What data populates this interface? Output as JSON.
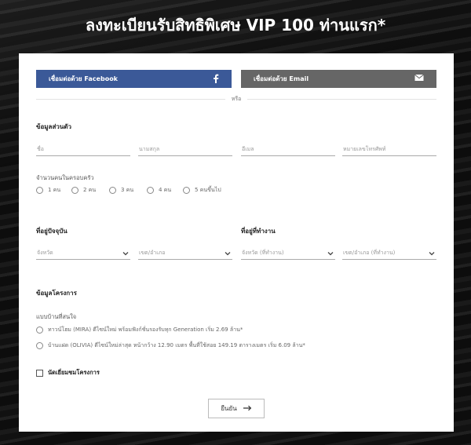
{
  "page": {
    "title": "ลงทะเบียนรับสิทธิพิเศษ VIP 100 ท่านแรก*"
  },
  "social": {
    "facebook_label": "เชื่อมต่อด้วย Facebook",
    "email_label": "เชื่อมต่อด้วย Email",
    "or_text": "หรือ"
  },
  "personal": {
    "title": "ข้อมูลส่วนตัว",
    "first_name_placeholder": "ชื่อ",
    "last_name_placeholder": "นามสกุล",
    "email_placeholder": "อีเมล",
    "phone_placeholder": "หมายเลขโทรศัพท์"
  },
  "family": {
    "label": "จำนวนคนในครอบครัว",
    "options": [
      "1 คน",
      "2 คน",
      "3 คน",
      "4 คน",
      "5 คนขึ้นไป"
    ]
  },
  "current_address": {
    "title": "ที่อยู่ปัจจุบัน",
    "province": "จังหวัด",
    "district": "เขต/อำเภอ"
  },
  "work_address": {
    "title": "ที่อยู่ที่ทำงาน",
    "province": "จังหวัด (ที่ทำงาน)",
    "district": "เขต/อำเภอ (ที่ทำงาน)"
  },
  "project": {
    "title": "ข้อมูลโครงการ",
    "interest_label": "แบบบ้านที่สนใจ",
    "options": [
      "ทาวน์โฮม (MIRA) ดีไซน์ใหม่ พร้อมฟังก์ชั่นรองรับทุก Generation เริ่ม 2.69 ล้าน*",
      "บ้านแฝด (OLIVIA) ดีไซน์ใหม่ล่าสุด หน้ากว้าง 12.90 เมตร พื้นที่ใช้สอย 149.19 ตารางเมตร เริ่ม 6.09 ล้าน*"
    ],
    "appointment_label": "นัดเยี่ยมชมโครงการ"
  },
  "submit": {
    "label": "ยืนยัน"
  },
  "colors": {
    "facebook": "#3b5998",
    "email": "#666666"
  }
}
